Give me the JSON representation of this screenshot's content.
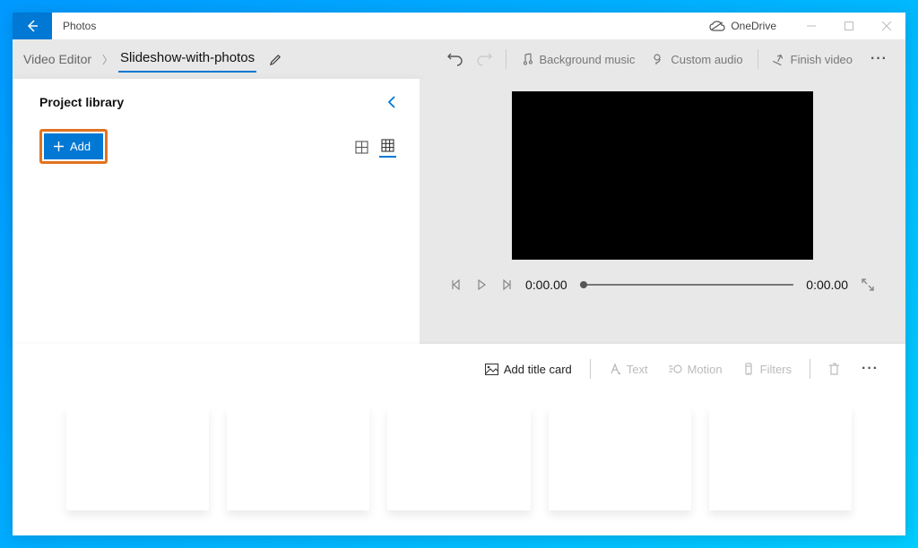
{
  "titlebar": {
    "app_name": "Photos",
    "onedrive_label": "OneDrive"
  },
  "breadcrumb": {
    "root": "Video Editor",
    "project_name": "Slideshow-with-photos"
  },
  "toolbar": {
    "background_music": "Background music",
    "custom_audio": "Custom audio",
    "finish_video": "Finish video"
  },
  "library": {
    "title": "Project library",
    "add_label": "Add"
  },
  "player": {
    "current_time": "0:00.00",
    "total_time": "0:00.00"
  },
  "storyboard": {
    "add_title_card": "Add title card",
    "text": "Text",
    "motion": "Motion",
    "filters": "Filters"
  }
}
